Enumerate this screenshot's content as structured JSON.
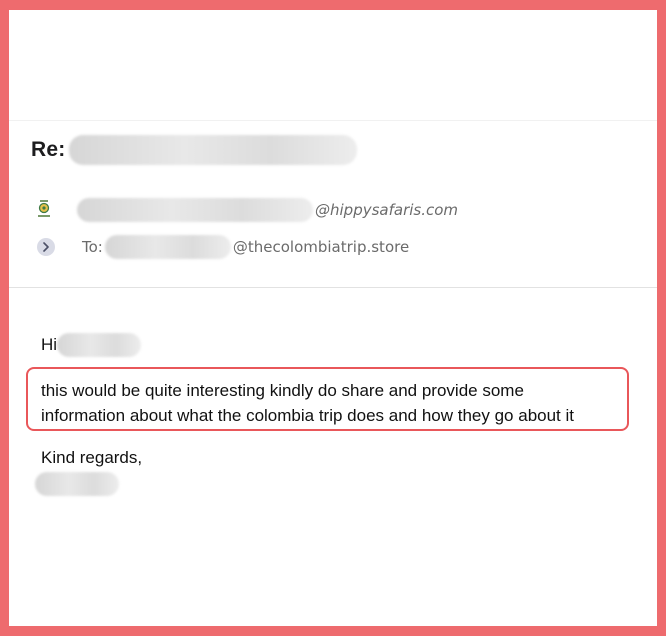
{
  "email": {
    "subject_prefix": "Re:",
    "sender": {
      "domain": "@hippysafaris.com",
      "logo_icon": "safari-logo-icon"
    },
    "recipient": {
      "label": "To:",
      "domain": "@thecolombiatrip.store",
      "expand_icon": "chevron-right-icon"
    },
    "body": {
      "greeting": "Hi",
      "message_lines": [
        "this would be quite interesting kindly do share and provide some",
        "information about what the colombia trip does and how they go about it"
      ],
      "closing": "Kind regards,"
    }
  },
  "colors": {
    "frame": "#ee6b6e",
    "highlight_border": "#e9575a",
    "text": "#111111",
    "meta_text": "#6b6b6b"
  }
}
